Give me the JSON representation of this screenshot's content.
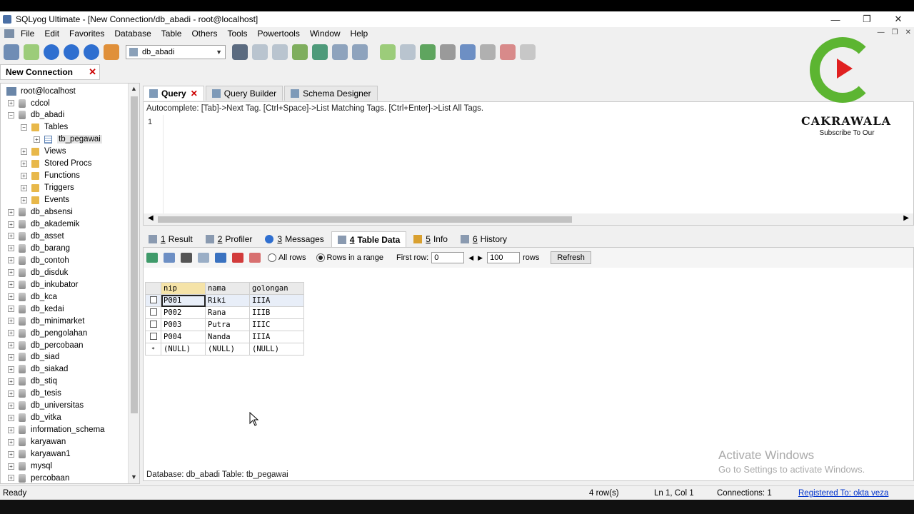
{
  "window": {
    "title": "SQLyog Ultimate - [New Connection/db_abadi - root@localhost]",
    "controls": [
      "—",
      "❐",
      "✕"
    ]
  },
  "menu": [
    "File",
    "Edit",
    "Favorites",
    "Database",
    "Table",
    "Others",
    "Tools",
    "Powertools",
    "Window",
    "Help"
  ],
  "toolbar": {
    "database_select": "db_abadi"
  },
  "connection_tab": {
    "label": "New Connection",
    "close": "✕"
  },
  "tree": {
    "root": "root@localhost",
    "items": [
      {
        "label": "cdcol",
        "level": 1,
        "expander": "+",
        "type": "db"
      },
      {
        "label": "db_abadi",
        "level": 1,
        "expander": "−",
        "type": "db"
      },
      {
        "label": "Tables",
        "level": 2,
        "expander": "−",
        "type": "folder"
      },
      {
        "label": "tb_pegawai",
        "level": 3,
        "expander": "+",
        "type": "table"
      },
      {
        "label": "Views",
        "level": 2,
        "expander": "+",
        "type": "folder"
      },
      {
        "label": "Stored Procs",
        "level": 2,
        "expander": "+",
        "type": "folder"
      },
      {
        "label": "Functions",
        "level": 2,
        "expander": "+",
        "type": "folder"
      },
      {
        "label": "Triggers",
        "level": 2,
        "expander": "+",
        "type": "folder"
      },
      {
        "label": "Events",
        "level": 2,
        "expander": "+",
        "type": "folder"
      },
      {
        "label": "db_absensi",
        "level": 1,
        "expander": "+",
        "type": "db"
      },
      {
        "label": "db_akademik",
        "level": 1,
        "expander": "+",
        "type": "db"
      },
      {
        "label": "db_asset",
        "level": 1,
        "expander": "+",
        "type": "db"
      },
      {
        "label": "db_barang",
        "level": 1,
        "expander": "+",
        "type": "db"
      },
      {
        "label": "db_contoh",
        "level": 1,
        "expander": "+",
        "type": "db"
      },
      {
        "label": "db_disduk",
        "level": 1,
        "expander": "+",
        "type": "db"
      },
      {
        "label": "db_inkubator",
        "level": 1,
        "expander": "+",
        "type": "db"
      },
      {
        "label": "db_kca",
        "level": 1,
        "expander": "+",
        "type": "db"
      },
      {
        "label": "db_kedai",
        "level": 1,
        "expander": "+",
        "type": "db"
      },
      {
        "label": "db_minimarket",
        "level": 1,
        "expander": "+",
        "type": "db"
      },
      {
        "label": "db_pengolahan",
        "level": 1,
        "expander": "+",
        "type": "db"
      },
      {
        "label": "db_percobaan",
        "level": 1,
        "expander": "+",
        "type": "db"
      },
      {
        "label": "db_siad",
        "level": 1,
        "expander": "+",
        "type": "db"
      },
      {
        "label": "db_siakad",
        "level": 1,
        "expander": "+",
        "type": "db"
      },
      {
        "label": "db_stiq",
        "level": 1,
        "expander": "+",
        "type": "db"
      },
      {
        "label": "db_tesis",
        "level": 1,
        "expander": "+",
        "type": "db"
      },
      {
        "label": "db_universitas",
        "level": 1,
        "expander": "+",
        "type": "db"
      },
      {
        "label": "db_vitka",
        "level": 1,
        "expander": "+",
        "type": "db"
      },
      {
        "label": "information_schema",
        "level": 1,
        "expander": "+",
        "type": "db"
      },
      {
        "label": "karyawan",
        "level": 1,
        "expander": "+",
        "type": "db"
      },
      {
        "label": "karyawan1",
        "level": 1,
        "expander": "+",
        "type": "db"
      },
      {
        "label": "mysql",
        "level": 1,
        "expander": "+",
        "type": "db"
      },
      {
        "label": "percobaan",
        "level": 1,
        "expander": "+",
        "type": "db"
      }
    ]
  },
  "query_tabs": [
    {
      "label": "Query",
      "active": true,
      "close": "✕"
    },
    {
      "label": "Query Builder",
      "active": false
    },
    {
      "label": "Schema Designer",
      "active": false
    }
  ],
  "editor": {
    "autocomplete_hint": "Autocomplete: [Tab]->Next Tag. [Ctrl+Space]->List Matching Tags. [Ctrl+Enter]->List All Tags.",
    "line_number": "1"
  },
  "result_tabs": [
    {
      "num": "1",
      "label": "Result",
      "active": false
    },
    {
      "num": "2",
      "label": "Profiler",
      "active": false
    },
    {
      "num": "3",
      "label": "Messages",
      "active": false
    },
    {
      "num": "4",
      "label": "Table Data",
      "active": true
    },
    {
      "num": "5",
      "label": "Info",
      "active": false
    },
    {
      "num": "6",
      "label": "History",
      "active": false
    }
  ],
  "grid_toolbar": {
    "all_rows": "All rows",
    "rows_in_range": "Rows in a range",
    "first_row_label": "First row:",
    "first_row_value": "0",
    "rows_value": "100",
    "rows_label": "rows",
    "refresh": "Refresh"
  },
  "table": {
    "columns": [
      "nip",
      "nama",
      "golongan"
    ],
    "rows": [
      [
        "P001",
        "Riki",
        "IIIA"
      ],
      [
        "P002",
        "Rana",
        "IIIB"
      ],
      [
        "P003",
        "Putra",
        "IIIC"
      ],
      [
        "P004",
        "Nanda",
        "IIIA"
      ]
    ],
    "new_row": [
      "(NULL)",
      "(NULL)",
      "(NULL)"
    ],
    "new_row_marker": "*"
  },
  "panel_status": "Database: db_abadi Table: tb_pegawai",
  "status": {
    "left": "Ready",
    "rows": "4 row(s)",
    "position": "Ln 1, Col 1",
    "connections": "Connections: 1",
    "registered": "Registered To: okta veza"
  },
  "watermark": {
    "brand": "CAKRAWALA",
    "tagline": "Subscribe To Our",
    "activate_title": "Activate Windows",
    "activate_sub": "Go to Settings to activate Windows."
  },
  "colors": {
    "accent_green": "#5cb531",
    "accent_red": "#e02020",
    "link_blue": "#0033cc"
  }
}
